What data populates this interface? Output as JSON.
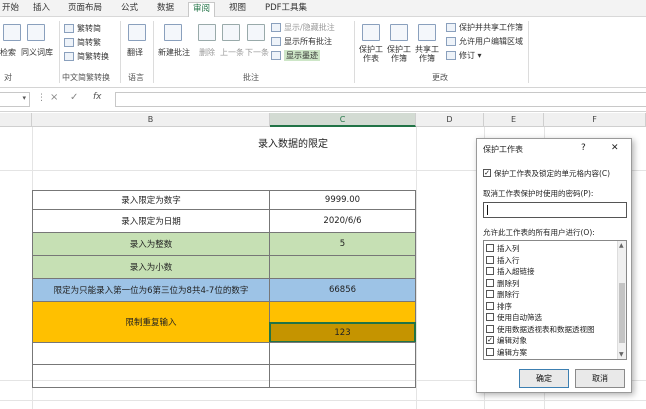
{
  "tabs": [
    "开始",
    "插入",
    "页面布局",
    "公式",
    "数据",
    "审阅",
    "视图",
    "PDF工具集"
  ],
  "ribbon": {
    "check_label": "检索",
    "thesaurus": "同义词库",
    "check_group": "对",
    "trad_to_simp": "繁转简",
    "simp_to_trad": "简转繁",
    "conversion": "简繁转换",
    "conv_group": "中文简繁转换",
    "translate": "翻译",
    "lang_group": "语言",
    "new_comment": "新建批注",
    "delete": "删除",
    "prev": "上一条",
    "next": "下一条",
    "show_hide_comment": "显示/隐藏批注",
    "show_all_comments": "显示所有批注",
    "show_ink": "显示墨迹",
    "comment_group": "批注",
    "protect_sheet": "保护工作表",
    "protect_book": "保护工作簿",
    "share_book": "共享工作簿",
    "protect_share": "保护并共享工作簿",
    "allow_edit": "允许用户编辑区域",
    "track": "修订",
    "changes_group": "更改"
  },
  "formula_bar": {
    "name_box": "",
    "cancel": "×",
    "enter": "✓",
    "fx": "fx",
    "value": ""
  },
  "columns": [
    "B",
    "C",
    "D",
    "E",
    "F"
  ],
  "sheet": {
    "title": "录入数据的限定",
    "rows": [
      {
        "label": "录入限定为数字",
        "value": "9999.00"
      },
      {
        "label": "录入限定为日期",
        "value": "2020/6/6"
      },
      {
        "label": "录入为整数",
        "value": "5"
      },
      {
        "label": "录入为小数",
        "value": ""
      },
      {
        "label": "限定为只能录入第一位为6第三位为8共4-7位的数字",
        "value": "66856"
      },
      {
        "label": "限制重复输入",
        "value": "123"
      }
    ]
  },
  "dialog": {
    "title": "保护工作表",
    "help": "?",
    "close": "✕",
    "protect_check": "保护工作表及锁定的单元格内容(C)",
    "password_label": "取消工作表保护时使用的密码(P):",
    "allow_label": "允许此工作表的所有用户进行(O):",
    "options": [
      {
        "label": "插入列",
        "checked": false
      },
      {
        "label": "插入行",
        "checked": false
      },
      {
        "label": "插入超链接",
        "checked": false
      },
      {
        "label": "删除列",
        "checked": false
      },
      {
        "label": "删除行",
        "checked": false
      },
      {
        "label": "排序",
        "checked": false
      },
      {
        "label": "使用自动筛选",
        "checked": false
      },
      {
        "label": "使用数据透视表和数据透视图",
        "checked": false
      },
      {
        "label": "编辑对象",
        "checked": true
      },
      {
        "label": "编辑方案",
        "checked": false
      }
    ],
    "ok": "确定",
    "cancel": "取消"
  },
  "colors": {
    "green": "#c6e0b4",
    "blue": "#9dc3e6",
    "orange": "#ffc000",
    "orange_dark": "#c59400",
    "accent": "#217346"
  }
}
